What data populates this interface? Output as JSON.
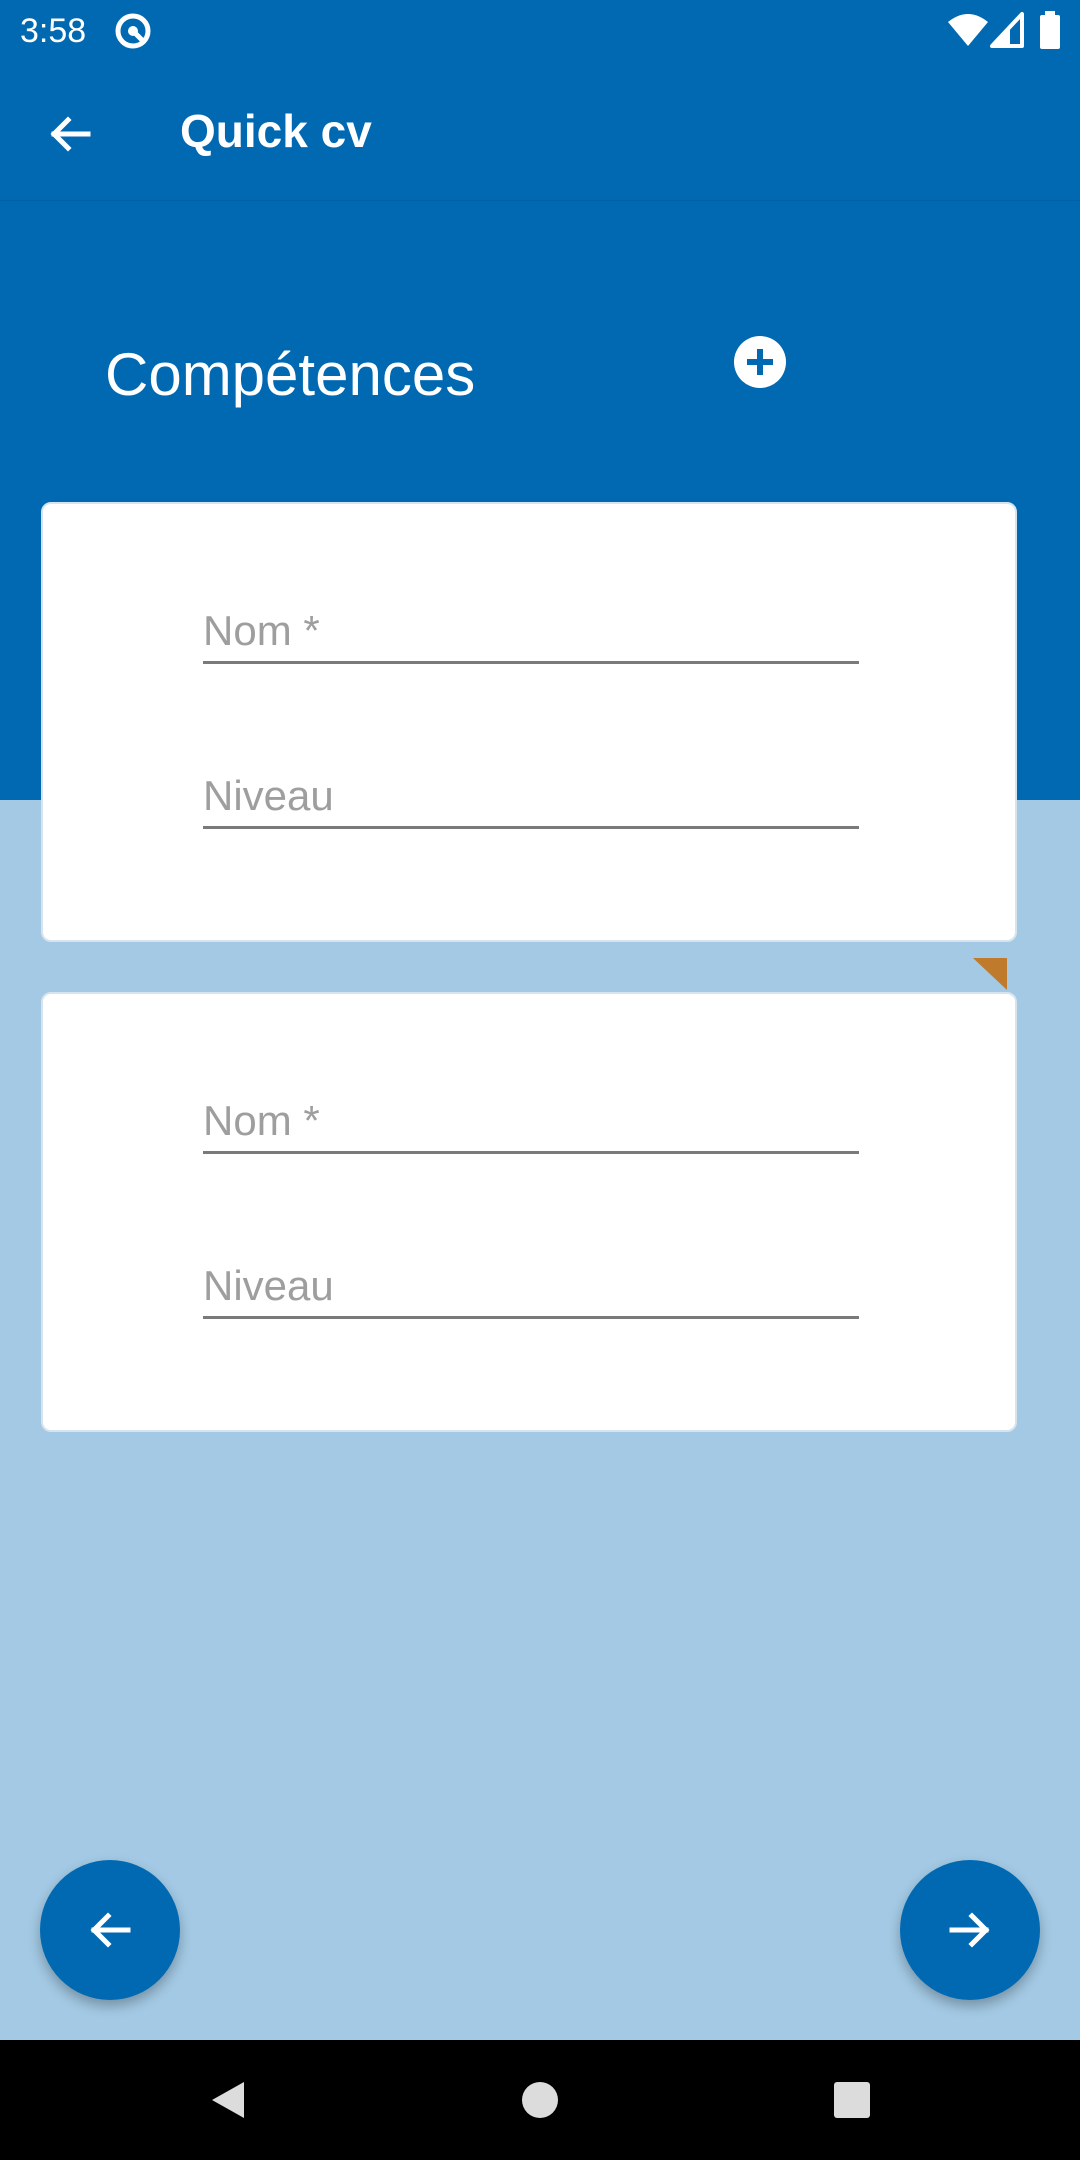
{
  "status_bar": {
    "time": "3:58",
    "app_icon": "at-sign-icon",
    "wifi_icon": "wifi-icon",
    "signal_icon": "cell-signal-icon",
    "battery_icon": "battery-icon"
  },
  "app_bar": {
    "back_icon": "arrow-left-icon",
    "title": "Quick cv"
  },
  "section": {
    "title": "Compétences",
    "add_icon": "plus-circle-icon"
  },
  "cards": [
    {
      "nom": {
        "placeholder": "Nom *",
        "value": ""
      },
      "niveau": {
        "placeholder": "Niveau",
        "value": ""
      }
    },
    {
      "nom": {
        "placeholder": "Nom *",
        "value": ""
      },
      "niveau": {
        "placeholder": "Niveau",
        "value": ""
      }
    }
  ],
  "navigation": {
    "prev_icon": "arrow-left-icon",
    "next_icon": "arrow-right-icon"
  },
  "system_nav": {
    "back_icon": "triangle-back-icon",
    "home_icon": "circle-home-icon",
    "recents_icon": "square-recents-icon"
  },
  "colors": {
    "primary": "#0169b2",
    "background_light": "#a3c9e4",
    "card": "#ffffff",
    "accent_marker": "#c07a2c"
  }
}
